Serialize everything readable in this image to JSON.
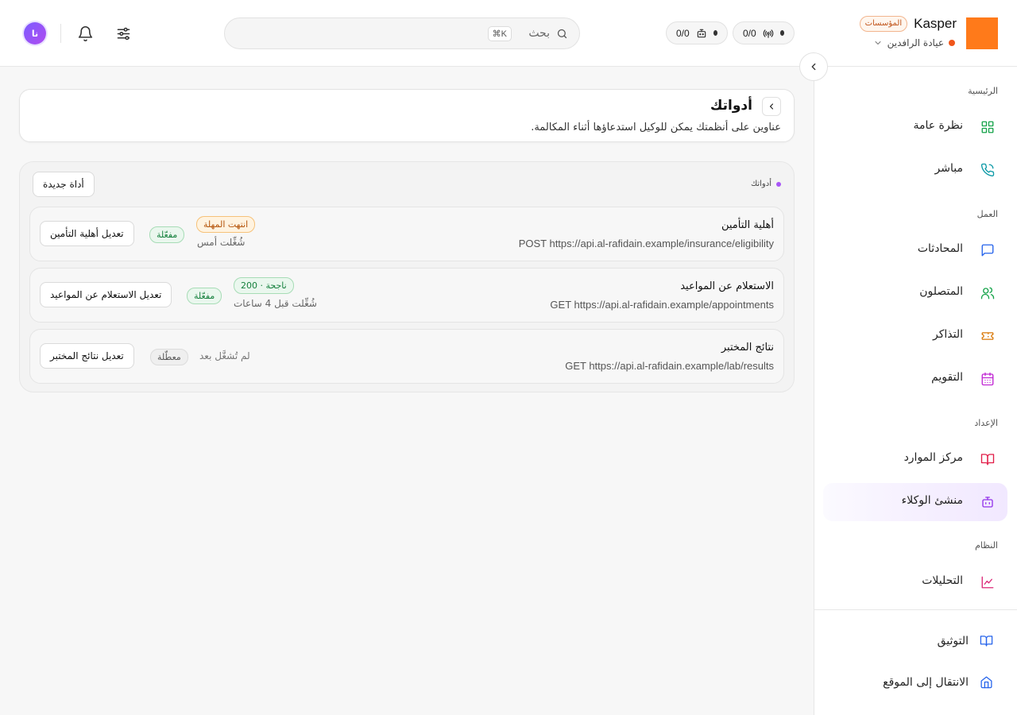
{
  "header": {
    "brand_name": "Kasper",
    "tier_badge": "المؤسسات",
    "org_name": "عيادة الرافدين",
    "counters": [
      {
        "value": "0/0",
        "icon": "antenna-icon"
      },
      {
        "value": "0/0",
        "icon": "bot-icon"
      }
    ],
    "search_placeholder": "بحث",
    "search_shortcut": "⌘K",
    "avatar_initials": "نا"
  },
  "sidebar": {
    "sections": [
      {
        "title": "الرئيسية",
        "items": [
          {
            "label": "نظرة عامة",
            "icon": "grid-icon",
            "color": "#16a34a"
          },
          {
            "label": "مباشر",
            "icon": "phone-icon",
            "color": "#0e9aa7"
          }
        ]
      },
      {
        "title": "العمل",
        "items": [
          {
            "label": "المحادثات",
            "icon": "chat-icon",
            "color": "#2563eb"
          },
          {
            "label": "المتصلون",
            "icon": "users-icon",
            "color": "#16a34a"
          },
          {
            "label": "التذاكر",
            "icon": "ticket-icon",
            "color": "#d97706"
          },
          {
            "label": "التقويم",
            "icon": "calendar-icon",
            "color": "#c026d3"
          }
        ]
      },
      {
        "title": "الإعداد",
        "items": [
          {
            "label": "مركز الموارد",
            "icon": "book-icon",
            "color": "#e11d48"
          },
          {
            "label": "منشئ الوكلاء",
            "icon": "bot-icon",
            "color": "#9333ea",
            "active": true
          }
        ]
      },
      {
        "title": "النظام",
        "items": [
          {
            "label": "التحليلات",
            "icon": "chart-icon",
            "color": "#db2777"
          }
        ]
      }
    ],
    "footer": [
      {
        "label": "التوثيق",
        "icon": "book-open-icon",
        "color": "#2563eb"
      },
      {
        "label": "الانتقال إلى الموقع",
        "icon": "home-icon",
        "color": "#2563eb"
      }
    ]
  },
  "page": {
    "title": "أدواتك",
    "subtitle": "عناوين على أنظمتك يمكن للوكيل استدعاؤها أثناء المكالمة."
  },
  "panel": {
    "label": "أدواتك",
    "new_tool_label": "أداة جديدة",
    "tools": [
      {
        "name": "أهلية التأمين",
        "endpoint": "POST https://api.al-rafidain.example/insurance/eligibility",
        "status": "انتهت المهلة",
        "last_run": "شُغِّلت أمس",
        "state": "مفعّلة",
        "edit_label": "تعديل أهلية التأمين"
      },
      {
        "name": "الاستعلام عن المواعيد",
        "endpoint": "GET https://api.al-rafidain.example/appointments",
        "status": "ناجحة · 200",
        "last_run": "شُغِّلت قبل 4 ساعات",
        "state": "مفعّلة",
        "edit_label": "تعديل الاستعلام عن المواعيد"
      },
      {
        "name": "نتائج المختبر",
        "endpoint": "GET https://api.al-rafidain.example/lab/results",
        "last_run": "لم تُشغَّل بعد",
        "state": "معطّلة",
        "edit_label": "تعديل نتائج المختبر"
      }
    ]
  },
  "colors": {
    "accent": "#a855f7",
    "logo": "#ff7a1a",
    "success": "#15803d",
    "warning": "#b45309"
  }
}
